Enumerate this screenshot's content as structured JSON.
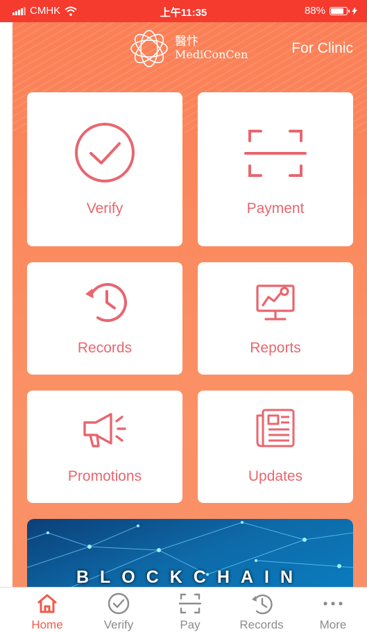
{
  "status_bar": {
    "carrier": "CMHK",
    "time": "上午11:35",
    "battery": "88%",
    "battery_level": 0.88
  },
  "header": {
    "logo_cn": "醫忭",
    "logo_en": "MediConCen",
    "for_clinic": "For Clinic"
  },
  "tiles": [
    {
      "label": "Verify",
      "icon": "check-circle-icon"
    },
    {
      "label": "Payment",
      "icon": "scan-icon"
    },
    {
      "label": "Records",
      "icon": "history-icon"
    },
    {
      "label": "Reports",
      "icon": "presentation-chart-icon"
    },
    {
      "label": "Promotions",
      "icon": "megaphone-icon"
    },
    {
      "label": "Updates",
      "icon": "newspaper-icon"
    }
  ],
  "banner": {
    "title": "BLOCKCHAIN"
  },
  "tab_bar": [
    {
      "label": "Home",
      "icon": "home-icon",
      "active": true
    },
    {
      "label": "Verify",
      "icon": "check-circle-icon",
      "active": false
    },
    {
      "label": "Pay",
      "icon": "scan-icon",
      "active": false
    },
    {
      "label": "Records",
      "icon": "history-icon",
      "active": false
    },
    {
      "label": "More",
      "icon": "more-dots-icon",
      "active": false
    }
  ],
  "colors": {
    "status_bar": "#f53a2e",
    "accent": "#e8666e",
    "active_tab": "#f05a4a",
    "inactive_tab": "#8c8c8c"
  }
}
